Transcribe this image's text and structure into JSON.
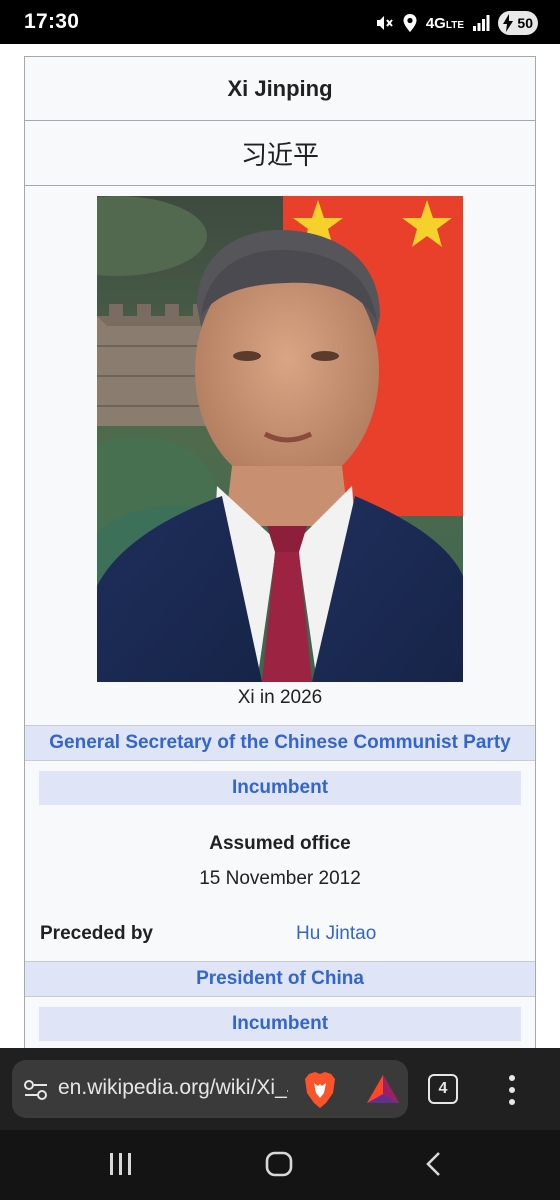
{
  "status_bar": {
    "time": "17:30",
    "network": "4G",
    "network_sub": "LTE",
    "battery": "50",
    "icons": [
      "mute-icon",
      "location-icon",
      "signal-icon",
      "battery-charging-icon"
    ]
  },
  "infobox": {
    "title": "Xi Jinping",
    "native_name": "习近平",
    "image_caption": "Xi in 2026",
    "sections": [
      {
        "header": "General Secretary of the Chinese Communist Party",
        "status": "Incumbent",
        "assumed_office_label": "Assumed office",
        "assumed_office_date": "15 November 2012",
        "preceded_by_label": "Preceded by",
        "preceded_by_value": "Hu Jintao"
      },
      {
        "header": "President of China",
        "status": "Incumbent"
      }
    ]
  },
  "browser": {
    "url": "en.wikipedia.org/wiki/Xi_Jinping",
    "tab_count": "4",
    "icons": [
      "site-settings-icon",
      "brave-shields-icon",
      "brave-rewards-icon",
      "menu-icon"
    ]
  },
  "nav": {
    "icons": [
      "recents-icon",
      "home-icon",
      "back-icon"
    ]
  },
  "colors": {
    "link": "#3366cc",
    "section_bg": "#dfe4f7",
    "infobox_bg": "#f8f9fa",
    "infobox_border": "#a2a9b1",
    "toolbar_bg": "#202020"
  }
}
